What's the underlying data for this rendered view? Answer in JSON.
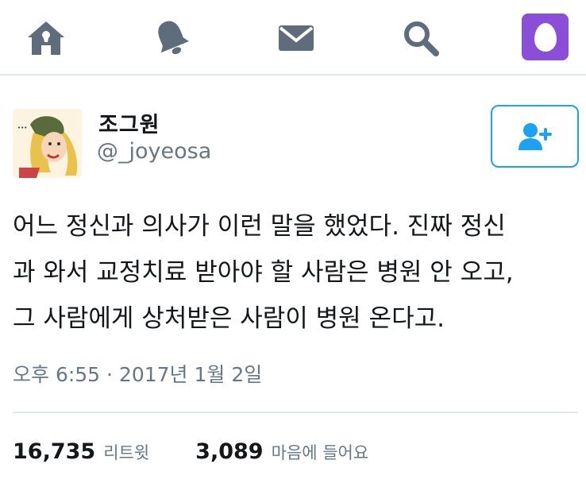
{
  "nav": {
    "items": [
      {
        "icon": "home-icon"
      },
      {
        "icon": "notifications-bell-icon"
      },
      {
        "icon": "messages-envelope-icon"
      },
      {
        "icon": "search-icon"
      },
      {
        "icon": "default-egg-avatar-icon"
      }
    ],
    "accent_color": "#5f6c7b",
    "avatar_color": "#8a4fd6"
  },
  "author": {
    "display_name": "조그원",
    "handle": "@_joyeosa",
    "avatar_icon": "cartoon-profile-avatar"
  },
  "follow_button": {
    "icon": "follow-user-plus-icon",
    "color": "#1da1f2"
  },
  "tweet": {
    "lines": [
      "어느 정신과 의사가 이런 말을 했었다. 진짜 정신",
      "과 와서 교정치료 받아야 할 사람은 병원 안 오고,",
      "그 사람에게 상처받은 사람이 병원 온다고."
    ],
    "timestamp": "오후 6:55 · 2017년 1월 2일"
  },
  "stats": {
    "retweets_count": "16,735",
    "retweets_label": "리트윗",
    "likes_count": "3,089",
    "likes_label": "마음에 들어요"
  }
}
